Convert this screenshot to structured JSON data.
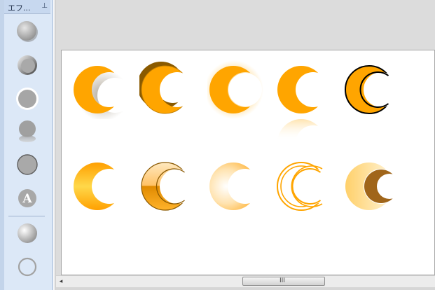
{
  "panel": {
    "title": "エフ...",
    "pin_icon": "pin-icon",
    "tools": [
      {
        "name": "effect-shadow-button"
      },
      {
        "name": "effect-bevel-button"
      },
      {
        "name": "effect-glow-button"
      },
      {
        "name": "effect-reflection-button"
      },
      {
        "name": "effect-outline-button"
      },
      {
        "name": "effect-text-style-button",
        "glyph": "A"
      },
      {
        "name": "effect-gradient-button"
      },
      {
        "name": "effect-no-fill-button"
      }
    ]
  },
  "canvas": {
    "rows": [
      [
        "shadow",
        "bevel",
        "glow",
        "reflection",
        "outline"
      ],
      [
        "gradient",
        "glass",
        "soft-fade",
        "double-outline",
        "layered"
      ]
    ]
  },
  "scrollbar": {
    "grip": "III",
    "left_arrow": "◂"
  },
  "colors": {
    "crescent": "#ffa500",
    "crescent_dark": "#a86b00",
    "panel_bg": "#dce8f7",
    "workspace_bg": "#dcdcdc"
  }
}
